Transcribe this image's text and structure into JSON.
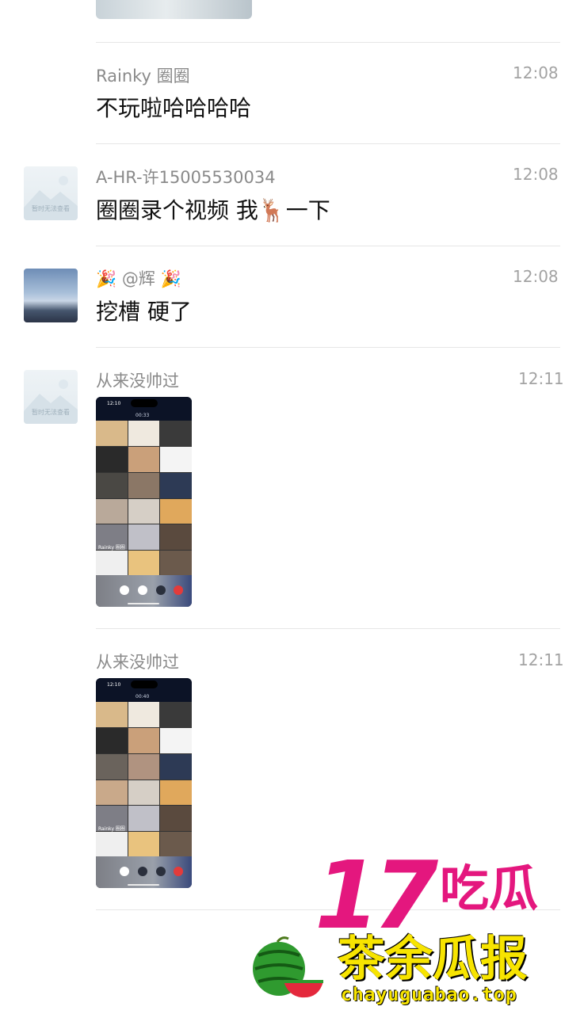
{
  "messages": [
    {
      "sender": "Rainky 圈圈",
      "time": "12:08",
      "text": "不玩啦哈哈哈哈"
    },
    {
      "sender": "A-HR-许15005530034",
      "time": "12:08",
      "text_before": "圈圈录个视频 我",
      "emoji": "🦌",
      "text_after": "一下",
      "avatar_caption": "暂时无法查看"
    },
    {
      "sender_prefix": "🎉",
      "sender": "@辉",
      "sender_suffix": "🎉",
      "time": "12:08",
      "text": "挖槽 硬了"
    },
    {
      "sender": "从来没帅过",
      "time": "12:11",
      "avatar_caption": "暂时无法查看",
      "screenshot": {
        "status_time": "12:10",
        "call_duration": "00:33",
        "tile_label": "Rainky 圈圈"
      }
    },
    {
      "sender": "从来没帅过",
      "time": "12:11",
      "screenshot": {
        "status_time": "12:10",
        "call_duration": "00:40",
        "tile_label": "Rainky 圈圈"
      }
    }
  ],
  "watermark": {
    "number": "17",
    "top_text": "吃瓜",
    "main_text": "茶余瓜报",
    "url": "chayuguabao.top",
    "colors": {
      "magenta": "#e4177e",
      "yellow": "#f7e400",
      "green": "#2f9a2f"
    }
  }
}
